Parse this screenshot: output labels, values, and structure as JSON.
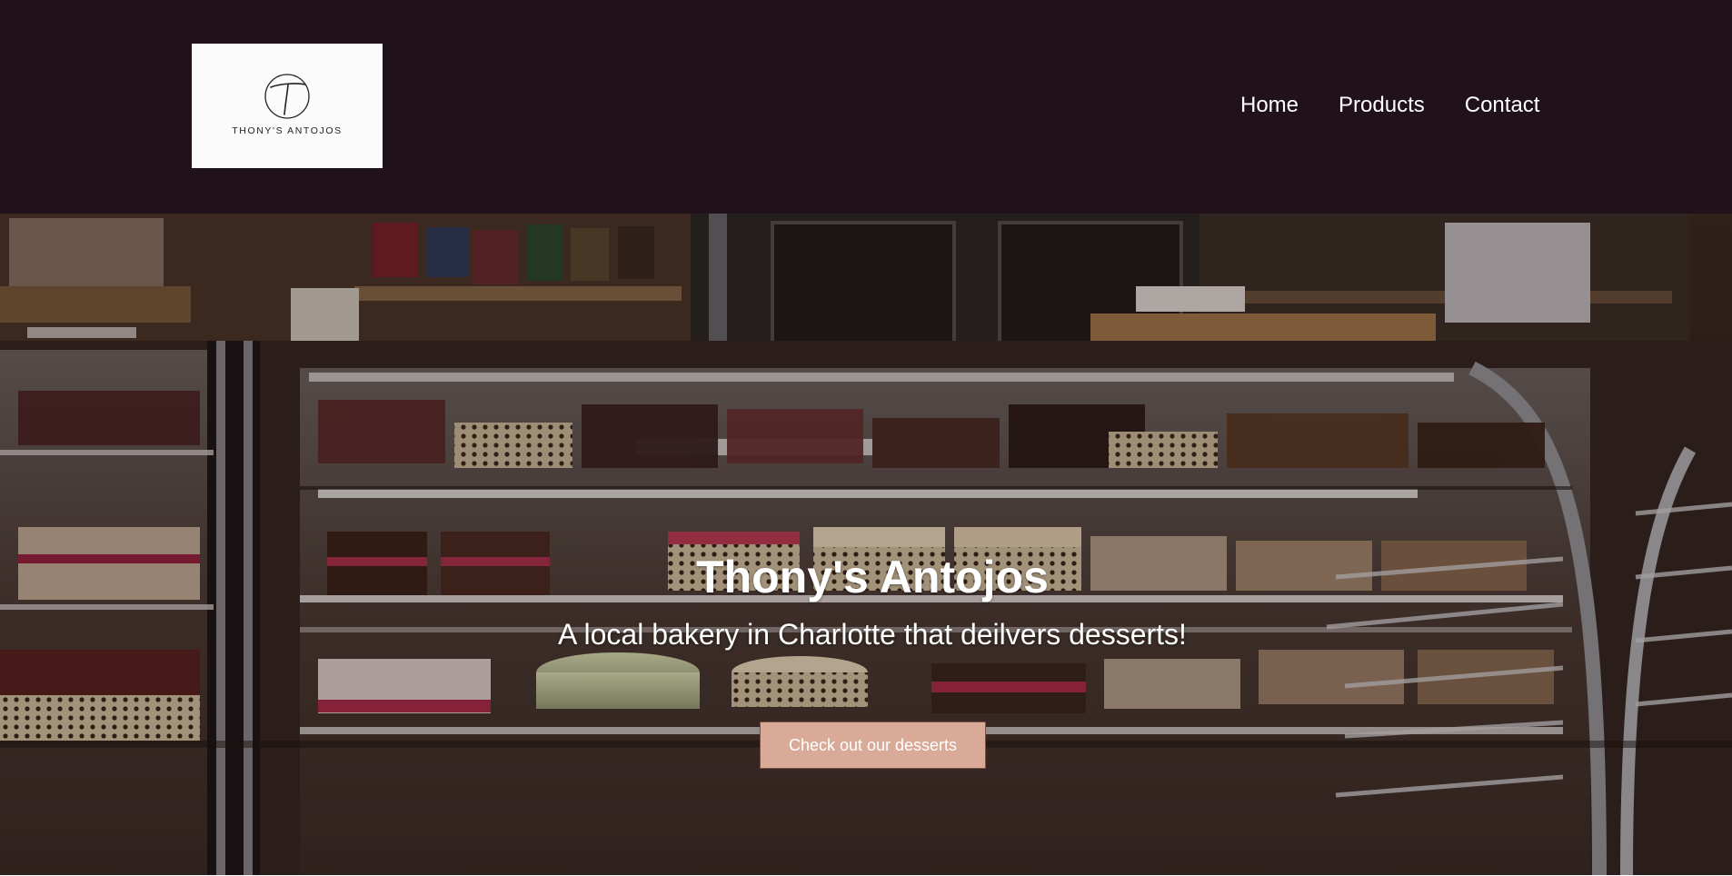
{
  "header": {
    "logo": {
      "text": "THONY'S ANTOJOS",
      "icon": "t-monogram-logo-icon"
    },
    "nav": [
      {
        "label": "Home"
      },
      {
        "label": "Products"
      },
      {
        "label": "Contact"
      }
    ],
    "background_color": "#20111b"
  },
  "hero": {
    "title": "Thony's Antojos",
    "subtitle": "A local bakery in Charlotte that deilvers desserts!",
    "cta_label": "Check out our desserts",
    "cta_color": "#d9aa98",
    "image_subject": "bakery display case with cakes"
  }
}
